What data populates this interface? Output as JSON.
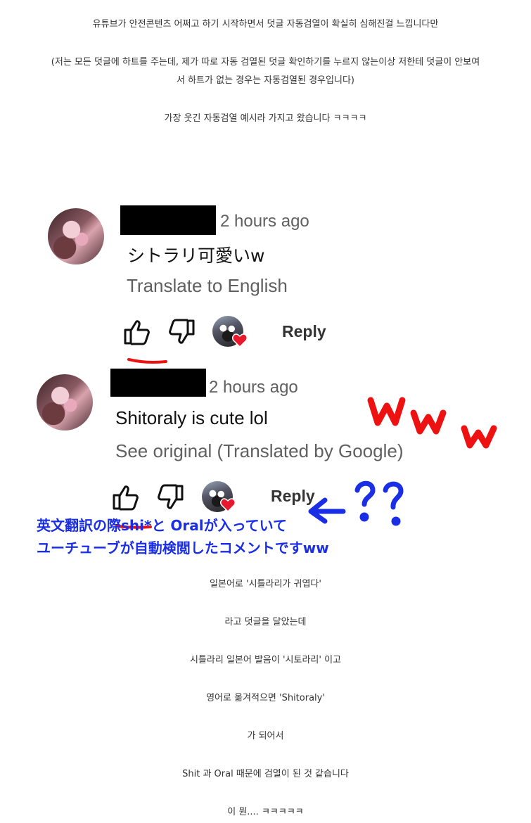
{
  "post": {
    "intro_line": "유튜브가 안전콘텐츠 어쩌고 하기 시작하면서 덧글 자동검열이 확실히 심해진걸 느낍니다만",
    "note_line_1": "(저는 모든 덧글에 하트를 주는데, 제가 따로 자동 검열된 덧글 확인하기를 누르지 않는이상 저한테 덧글이 안보여",
    "note_line_2": "서 하트가 없는 경우는 자동검열된 경우입니다)",
    "example_line": "가장 웃긴 자동검열 예시라 가지고 왔습니다 ㅋㅋㅋㅋ",
    "outro": [
      "일본어로 '시틀라리가 귀엽다'",
      "라고 덧글을 달았는데",
      "시틀라리 일본어 발음이 '시토라리' 이고",
      "영어로 옮겨적으면 'Shitoraly'",
      "가 되어서",
      "Shit 과 Oral 때문에 검열이 된 것 같습니다",
      "이 뭔.... ㅋㅋㅋㅋㅋ"
    ]
  },
  "comments": [
    {
      "time": "2 hours ago",
      "text": "シトラリ可愛いw",
      "link": "Translate to English",
      "reply_label": "Reply"
    },
    {
      "time": "2 hours ago",
      "text": "Shitoraly is cute lol",
      "link": "See original (Translated by Google)",
      "reply_label": "Reply"
    }
  ],
  "annotations": {
    "www": "www",
    "question": "??",
    "jp_line_1": "英文翻訳の際shi*と Oralが入っていて",
    "jp_line_2": "ユーチューブが自動検閲したコメントですww"
  },
  "colors": {
    "red_annotation": "#ee1111",
    "blue_annotation": "#1a2ee6",
    "heart": "#e8192c"
  },
  "icons": [
    "thumbs-up-icon",
    "thumbs-down-icon",
    "heart-icon"
  ]
}
